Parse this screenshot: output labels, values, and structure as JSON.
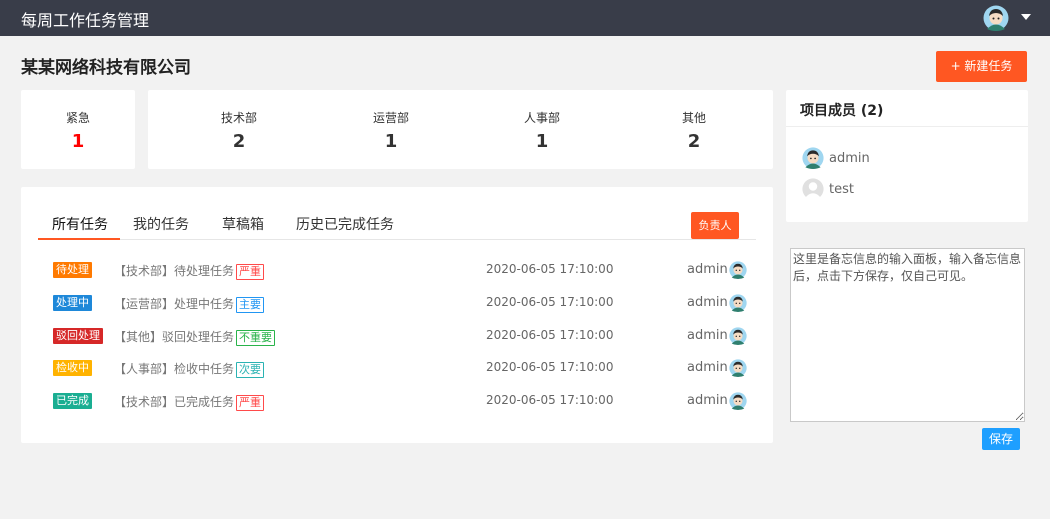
{
  "header": {
    "app_title": "每周工作任务管理",
    "avatar_icon": "user-avatar-icon",
    "menu_icon": "caret-down-icon"
  },
  "company": {
    "name": "某某网络科技有限公司"
  },
  "actions": {
    "new_task_label": "+ 新建任务"
  },
  "stats": {
    "urgent": {
      "label": "紧急",
      "value": "1",
      "color": "#ff0000"
    },
    "departments": [
      {
        "label": "技术部",
        "value": "2"
      },
      {
        "label": "运营部",
        "value": "1"
      },
      {
        "label": "人事部",
        "value": "1"
      },
      {
        "label": "其他",
        "value": "2"
      }
    ]
  },
  "members": {
    "title": "项目成员 (2)",
    "items": [
      {
        "name": "admin",
        "avatar_icon": "user-avatar-icon"
      },
      {
        "name": "test",
        "avatar_icon": "default-user-icon"
      }
    ]
  },
  "tabs": [
    {
      "label": "所有任务",
      "active": true
    },
    {
      "label": "我的任务",
      "active": false
    },
    {
      "label": "草稿箱",
      "active": false
    },
    {
      "label": "历史已完成任务",
      "active": false
    }
  ],
  "owner_button_label": "负责人",
  "tasks": [
    {
      "status": "待处理",
      "status_color": "#ff7a00",
      "title": "【技术部】待处理任务",
      "priority": "严重",
      "priority_color": "#ff4a4a",
      "time": "2020-06-05 17:10:00",
      "user": "admin"
    },
    {
      "status": "处理中",
      "status_color": "#1e88d9",
      "title": "【运营部】处理中任务",
      "priority": "主要",
      "priority_color": "#2196f3",
      "time": "2020-06-05 17:10:00",
      "user": "admin"
    },
    {
      "status": "驳回处理",
      "status_color": "#d62828",
      "title": "【其他】驳回处理任务",
      "priority": "不重要",
      "priority_color": "#29b34a",
      "time": "2020-06-05 17:10:00",
      "user": "admin"
    },
    {
      "status": "检收中",
      "status_color": "#ffb300",
      "title": "【人事部】检收中任务",
      "priority": "次要",
      "priority_color": "#2ab3b3",
      "time": "2020-06-05 17:10:00",
      "user": "admin"
    },
    {
      "status": "已完成",
      "status_color": "#1aae92",
      "title": "【技术部】已完成任务",
      "priority": "严重",
      "priority_color": "#ff4a4a",
      "time": "2020-06-05 17:10:00",
      "user": "admin"
    }
  ],
  "memo": {
    "value": "这里是备忘信息的输入面板，输入备忘信息后，点击下方保存，仅自己可见。",
    "save_label": "保存"
  },
  "colors": {
    "topbar": "#393d49",
    "accent": "#ff5722",
    "save": "#1e9fff",
    "background": "#f2f2f2"
  }
}
